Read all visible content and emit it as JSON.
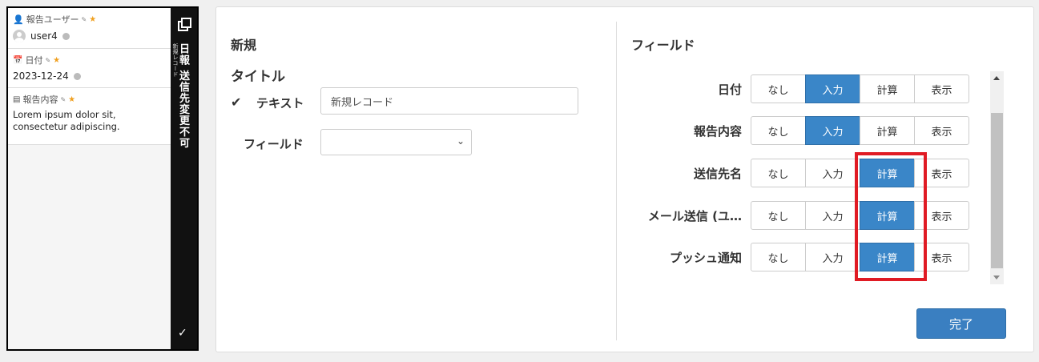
{
  "preview": {
    "fields": [
      {
        "label": "報告ユーザー",
        "value": "user4"
      },
      {
        "label": "日付",
        "value": "2023-12-24"
      },
      {
        "label": "報告内容",
        "value": "Lorem ipsum dolor sit, consectetur adipiscing."
      }
    ],
    "strip_title": "日報 送信先変更不可",
    "strip_subtitle": "新規レコード"
  },
  "left": {
    "section_title": "新規",
    "subsection_title": "タイトル",
    "text_label": "テキスト",
    "text_value": "新規レコード",
    "field_label": "フィールド",
    "field_value": ""
  },
  "right": {
    "section_title": "フィールド",
    "options": [
      "なし",
      "入力",
      "計算",
      "表示"
    ],
    "rows": [
      {
        "label": "日付",
        "selected": "入力"
      },
      {
        "label": "報告内容",
        "selected": "入力"
      },
      {
        "label": "送信先名",
        "selected": "計算"
      },
      {
        "label": "メール送信 (ユ…",
        "selected": "計算"
      },
      {
        "label": "プッシュ通知",
        "selected": "計算"
      }
    ],
    "done_label": "完了"
  },
  "colors": {
    "accent": "#3a86c8",
    "highlight": "#e01b24"
  }
}
